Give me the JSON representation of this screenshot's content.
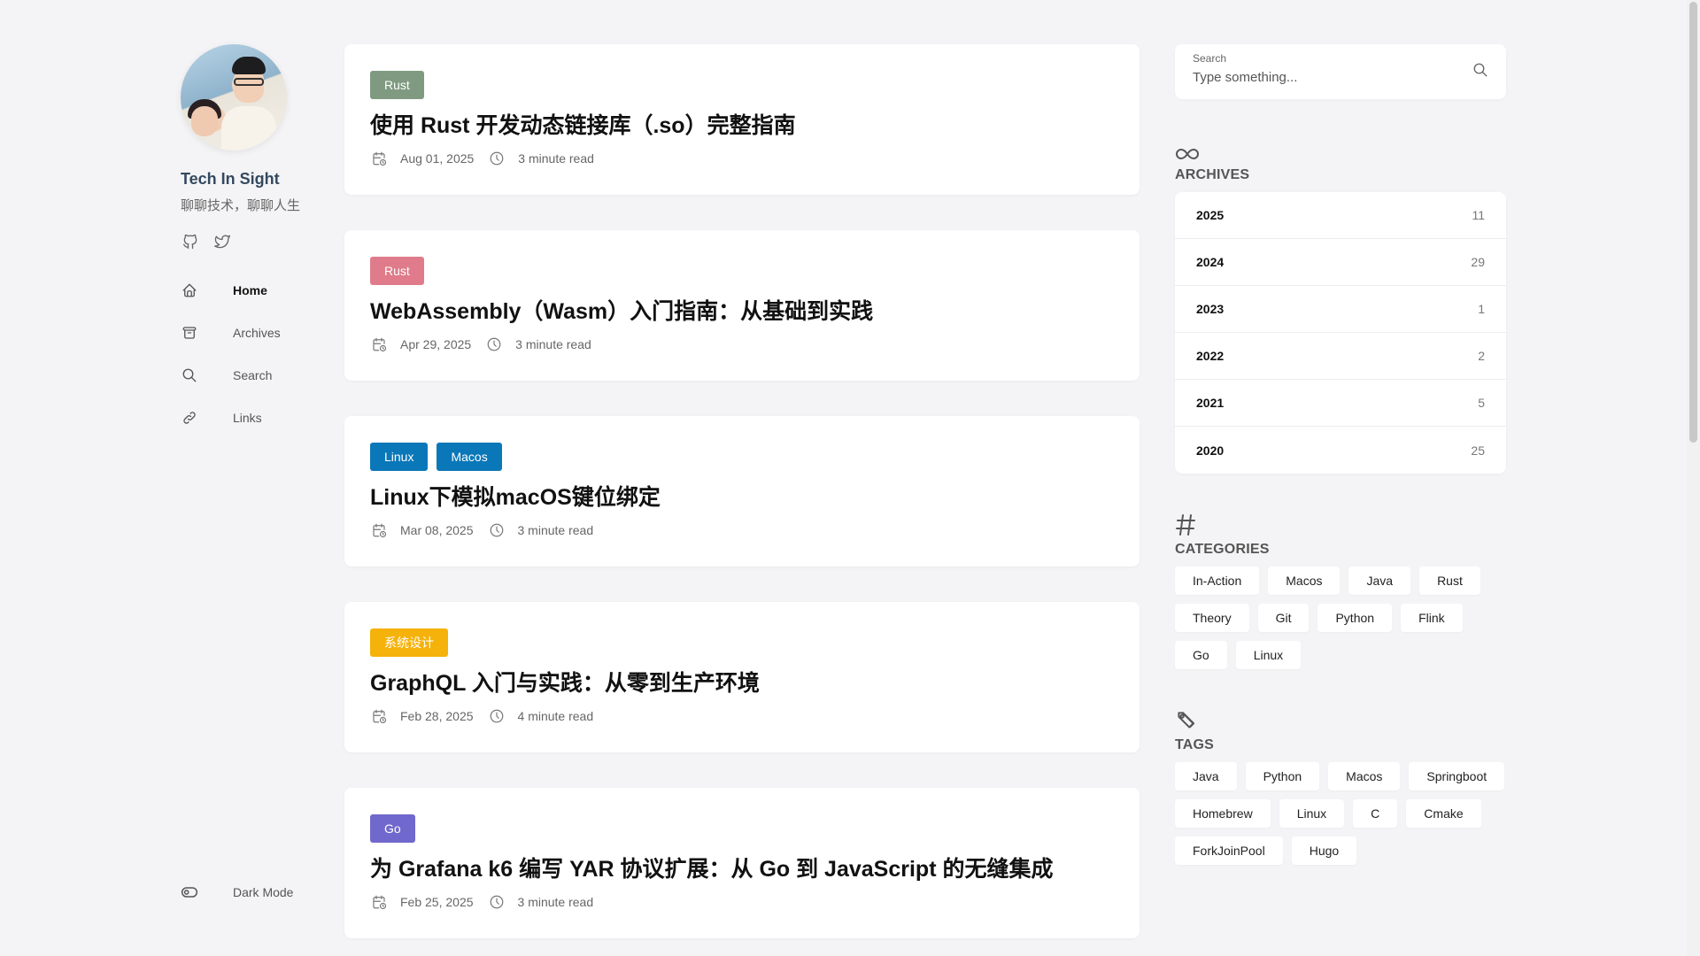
{
  "profile": {
    "title": "Tech In Sight",
    "subtitle": "聊聊技术，聊聊人生",
    "socials": [
      "github-icon",
      "twitter-icon"
    ]
  },
  "nav": [
    {
      "label": "Home",
      "icon": "home-icon",
      "active": true
    },
    {
      "label": "Archives",
      "icon": "archive-box-icon",
      "active": false
    },
    {
      "label": "Search",
      "icon": "search-icon",
      "active": false
    },
    {
      "label": "Links",
      "icon": "link-icon",
      "active": false
    }
  ],
  "dark_mode": {
    "label": "Dark Mode",
    "icon": "toggle-icon"
  },
  "posts": [
    {
      "tags": [
        {
          "label": "Rust",
          "color": "#7f9a80"
        }
      ],
      "title": "使用 Rust 开发动态链接库（.so）完整指南",
      "date": "Aug 01, 2025",
      "read": "3 minute read"
    },
    {
      "tags": [
        {
          "label": "Rust",
          "color": "#df7b8a"
        }
      ],
      "title": "WebAssembly（Wasm）入门指南：从基础到实践",
      "date": "Apr 29, 2025",
      "read": "3 minute read"
    },
    {
      "tags": [
        {
          "label": "Linux",
          "color": "#0a77b8"
        },
        {
          "label": "Macos",
          "color": "#0a77b8"
        }
      ],
      "title": "Linux下模拟macOS键位绑定",
      "date": "Mar 08, 2025",
      "read": "3 minute read"
    },
    {
      "tags": [
        {
          "label": "系统设计",
          "color": "#f5b20a"
        }
      ],
      "title": "GraphQL 入门与实践：从零到生产环境",
      "date": "Feb 28, 2025",
      "read": "4 minute read"
    },
    {
      "tags": [
        {
          "label": "Go",
          "color": "#7068cc"
        }
      ],
      "title": "为 Grafana k6 编写 YAR 协议扩展：从 Go 到 JavaScript 的无缝集成",
      "date": "Feb 25, 2025",
      "read": "3 minute read"
    }
  ],
  "search": {
    "label": "Search",
    "placeholder": "Type something..."
  },
  "archives": {
    "title": "ARCHIVES",
    "rows": [
      {
        "year": "2025",
        "count": "11"
      },
      {
        "year": "2024",
        "count": "29"
      },
      {
        "year": "2023",
        "count": "1"
      },
      {
        "year": "2022",
        "count": "2"
      },
      {
        "year": "2021",
        "count": "5"
      },
      {
        "year": "2020",
        "count": "25"
      }
    ]
  },
  "categories": {
    "title": "CATEGORIES",
    "items": [
      "In-Action",
      "Macos",
      "Java",
      "Rust",
      "Theory",
      "Git",
      "Python",
      "Flink",
      "Go",
      "Linux"
    ]
  },
  "tags": {
    "title": "TAGS",
    "items": [
      "Java",
      "Python",
      "Macos",
      "Springboot",
      "Homebrew",
      "Linux",
      "C",
      "Cmake",
      "ForkJoinPool",
      "Hugo"
    ]
  }
}
